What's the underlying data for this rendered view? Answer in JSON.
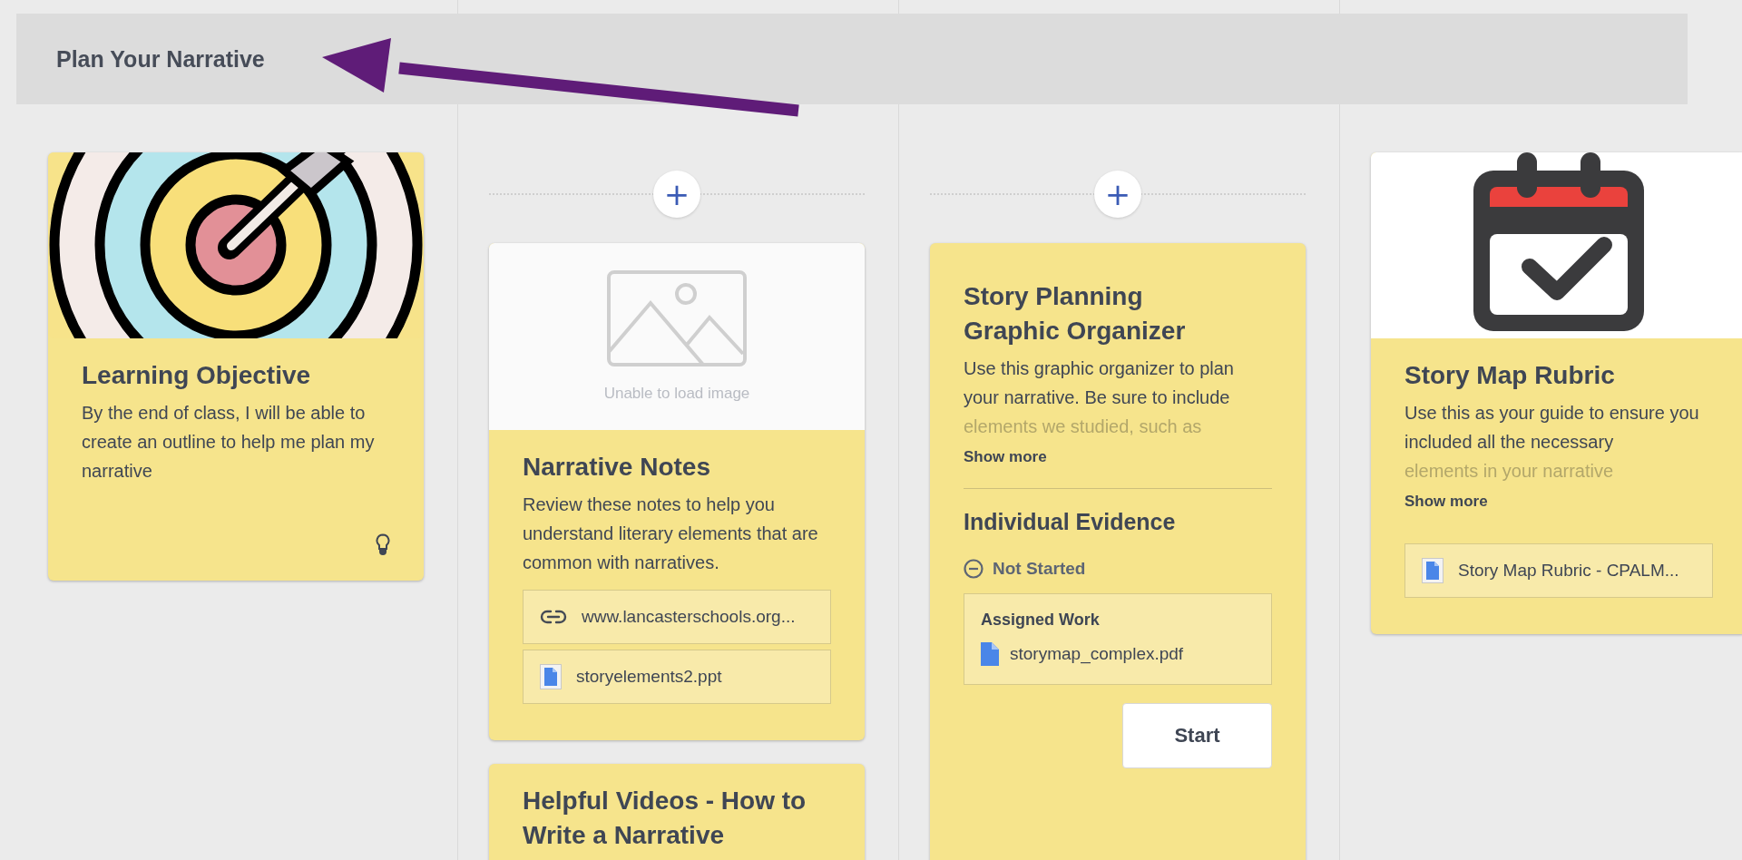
{
  "section": {
    "title": "Plan Your Narrative"
  },
  "columns": [
    {
      "cards": [
        {
          "kind": "objective",
          "picture": {
            "kind": "target"
          },
          "title": "Learning Objective",
          "description": "By the end of class, I will be able to create an outline to help me plan my narrative"
        }
      ]
    },
    {
      "add_button": "+",
      "cards": [
        {
          "kind": "resource",
          "picture": {
            "kind": "broken",
            "caption": "Unable to load image"
          },
          "title": "Narrative Notes",
          "description": "Review these notes to help you understand literary elements that are common with narratives.",
          "attachments": [
            {
              "kind": "link",
              "label": "www.lancasterschools.org..."
            },
            {
              "kind": "file",
              "label": "storyelements2.ppt"
            }
          ]
        },
        {
          "kind": "resource",
          "title": "Helpful Videos - How to Write a Narrative"
        }
      ]
    },
    {
      "add_button": "+",
      "cards": [
        {
          "kind": "evidence",
          "title": "Story Planning Graphic Organizer",
          "description": "Use this graphic organizer to plan your narrative. Be sure to include",
          "faded_text": "elements we studied, such as",
          "show_more": "Show more",
          "evidence": {
            "title": "Individual Evidence",
            "status": "Not Started",
            "assigned_title": "Assigned Work",
            "assigned_file": "storymap_complex.pdf",
            "start_button": "Start"
          }
        }
      ]
    },
    {
      "cards": [
        {
          "kind": "resource",
          "picture": {
            "kind": "calendar"
          },
          "title": "Story Map Rubric",
          "description": "Use this as your guide to ensure you included all the necessary",
          "faded_text": "elements in your narrative",
          "show_more": "Show more",
          "attachments": [
            {
              "kind": "file",
              "label": "Story Map Rubric - CPALM..."
            }
          ]
        }
      ]
    }
  ]
}
